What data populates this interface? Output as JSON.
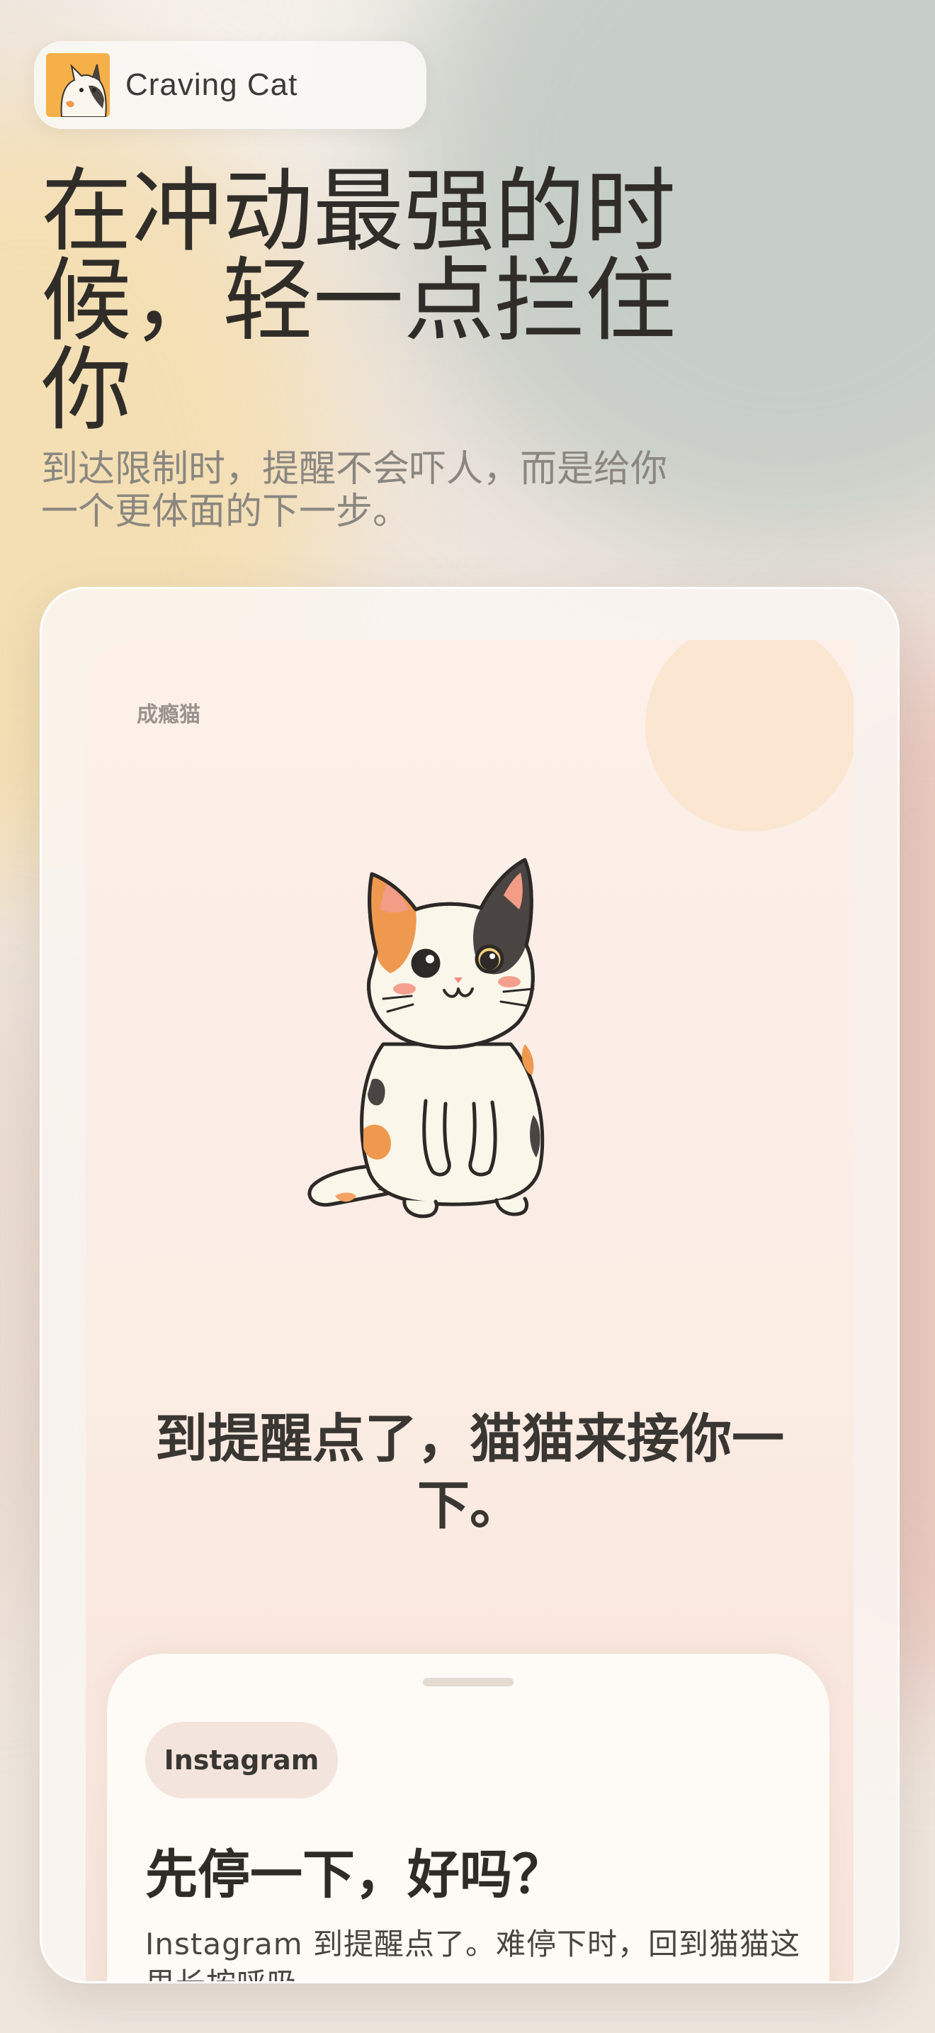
{
  "brand": {
    "name": "Craving Cat",
    "logo_icon": "calico-cat-icon"
  },
  "hero": {
    "headline": "在冲动最强的时候，轻一点拦住你",
    "subline": "到达限制时，提醒不会吓人，而是给你一个更体面的下一步。"
  },
  "device": {
    "app_label": "成瘾猫",
    "illustration": "calico-cat-icon",
    "message": "到提醒点了，猫猫来接你一下。",
    "sheet": {
      "app_chip": "Instagram",
      "title": "先停一下，好吗？",
      "body": "Instagram 到提醒点了。难停下时，回到猫猫这里长按呼吸。"
    }
  },
  "colors": {
    "accent_orange": "#f6b04a",
    "text_dark": "#302d29",
    "text_muted": "#8b8780",
    "chip_bg": "#f3e5dd",
    "sheet_bg": "#fefaf5"
  }
}
